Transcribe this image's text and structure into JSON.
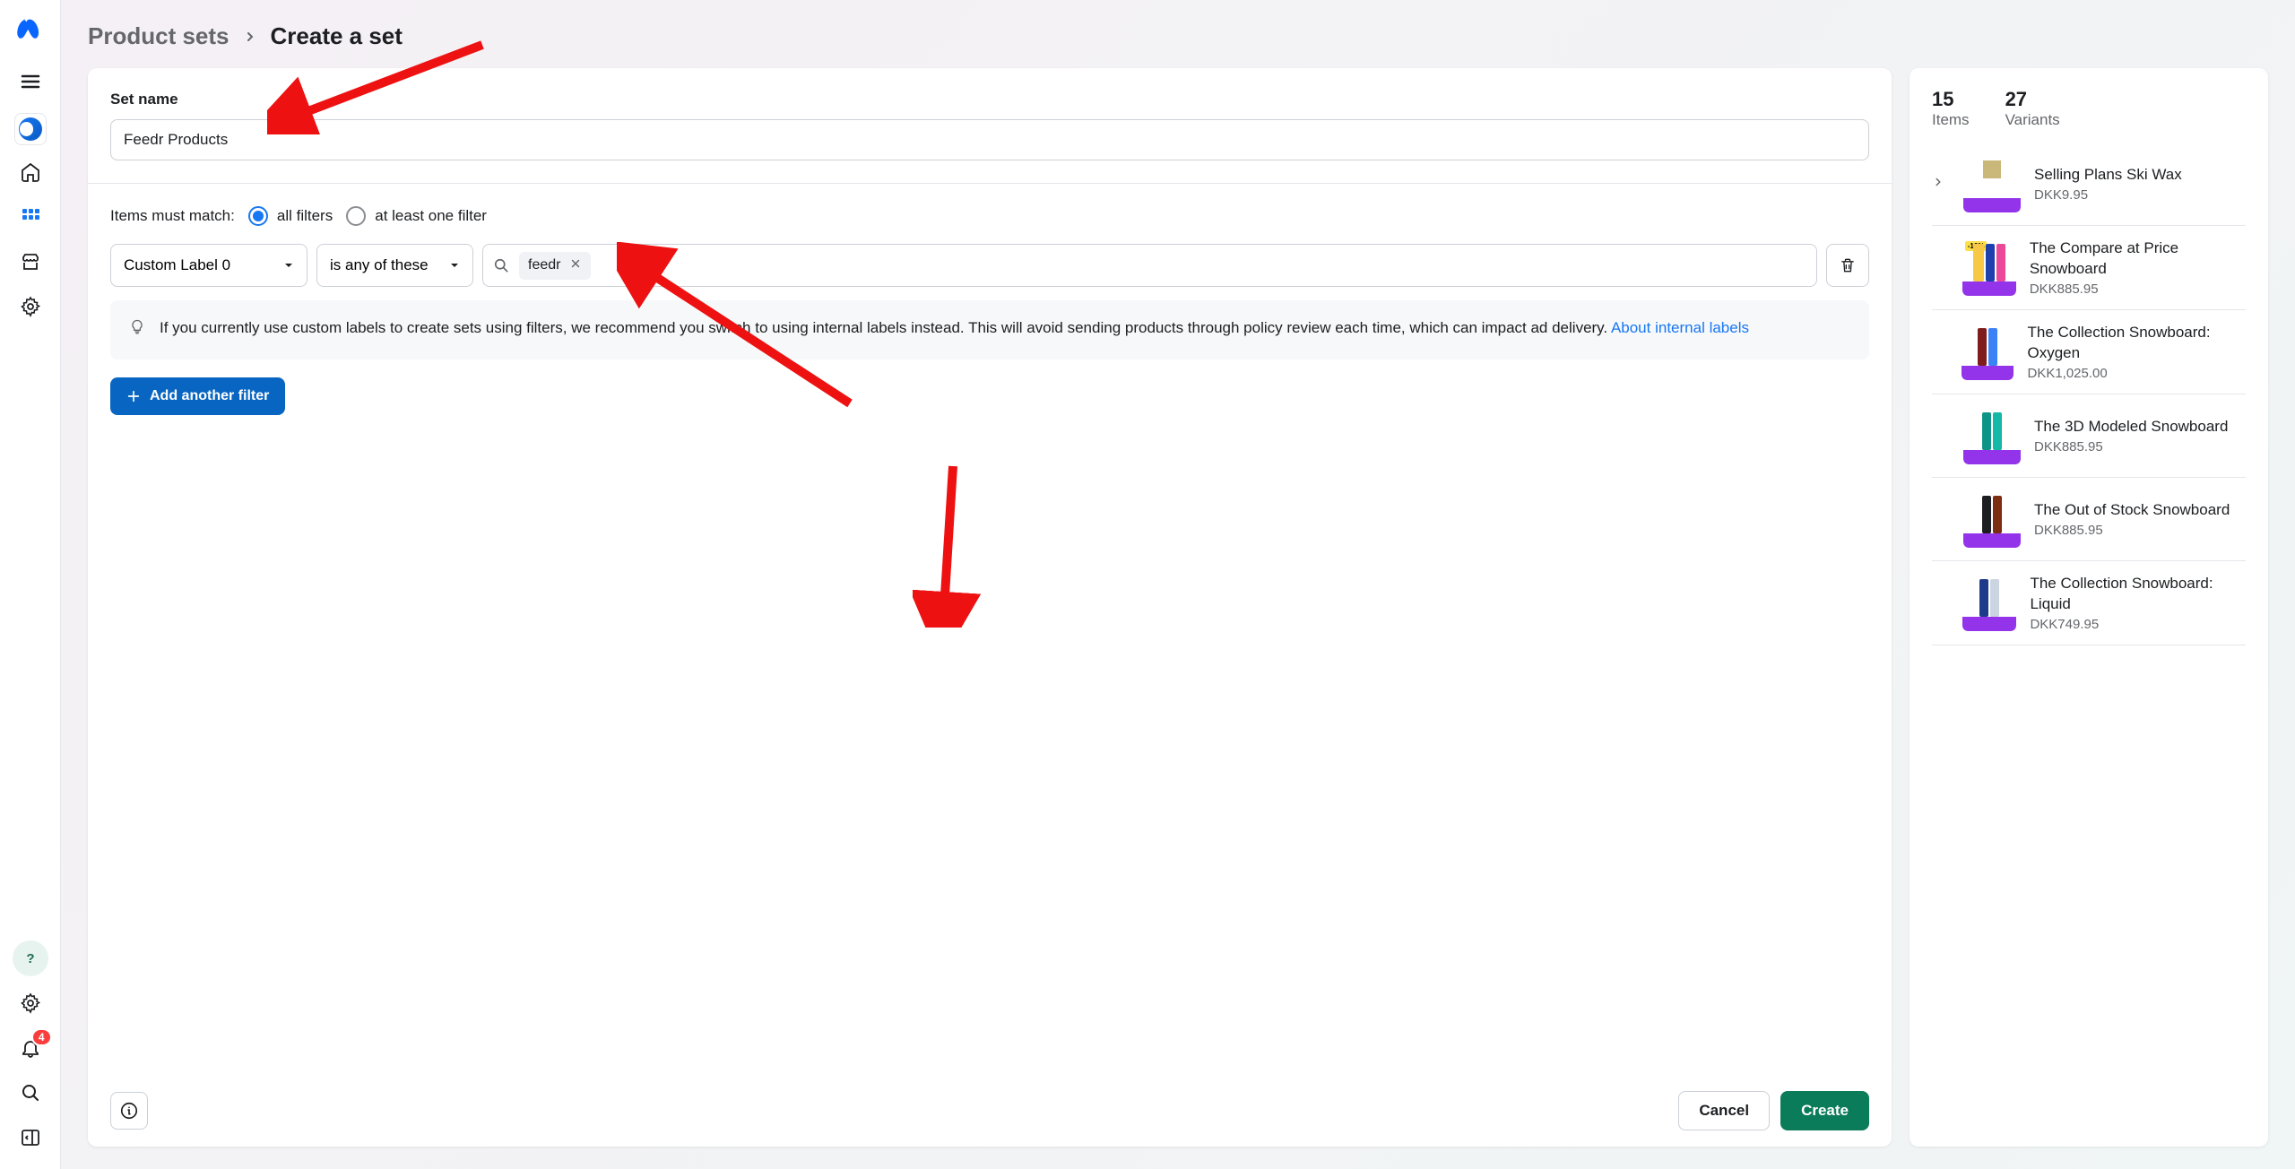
{
  "breadcrumb": {
    "parent": "Product sets",
    "current": "Create a set"
  },
  "form": {
    "set_name_label": "Set name",
    "set_name_value": "Feedr Products",
    "match_label": "Items must match:",
    "all_filters": "all filters",
    "at_least_one": "at least one filter",
    "filter_field": "Custom Label 0",
    "filter_op": "is any of these",
    "filter_value": "feedr",
    "info_text": "If you currently use custom labels to create sets using filters, we recommend you switch to using internal labels instead. This will avoid sending products through policy review each time, which can impact ad delivery. ",
    "info_link": "About internal labels",
    "add_filter": "Add another filter",
    "cancel": "Cancel",
    "create": "Create"
  },
  "preview": {
    "items_count": "15",
    "items_label": "Items",
    "variants_count": "27",
    "variants_label": "Variants",
    "products": [
      {
        "name": "Selling Plans Ski Wax",
        "price": "DKK9.95",
        "has_chev": true,
        "thumb": "box"
      },
      {
        "name": "The Compare at Price Snowboard",
        "price": "DKK885.95",
        "has_chev": false,
        "thumb": "blue",
        "sale": true
      },
      {
        "name": "The Collection Snowboard: Oxygen",
        "price": "DKK1,025.00",
        "has_chev": false,
        "thumb": "redblue"
      },
      {
        "name": "The 3D Modeled Snowboard",
        "price": "DKK885.95",
        "has_chev": false,
        "thumb": "teal"
      },
      {
        "name": "The Out of Stock Snowboard",
        "price": "DKK885.95",
        "has_chev": false,
        "thumb": "dark"
      },
      {
        "name": "The Collection Snowboard: Liquid",
        "price": "DKK749.95",
        "has_chev": false,
        "thumb": "navy"
      }
    ]
  },
  "sidebar": {
    "notif_count": "4"
  }
}
